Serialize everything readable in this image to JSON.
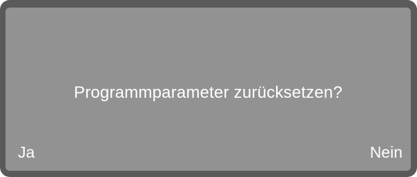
{
  "dialog": {
    "message": "Programmparameter zurücksetzen?",
    "confirm_label": "Ja",
    "cancel_label": "Nein"
  },
  "colors": {
    "bezel": "#5a5a5a",
    "screen": "#929292",
    "text": "#ffffff"
  }
}
